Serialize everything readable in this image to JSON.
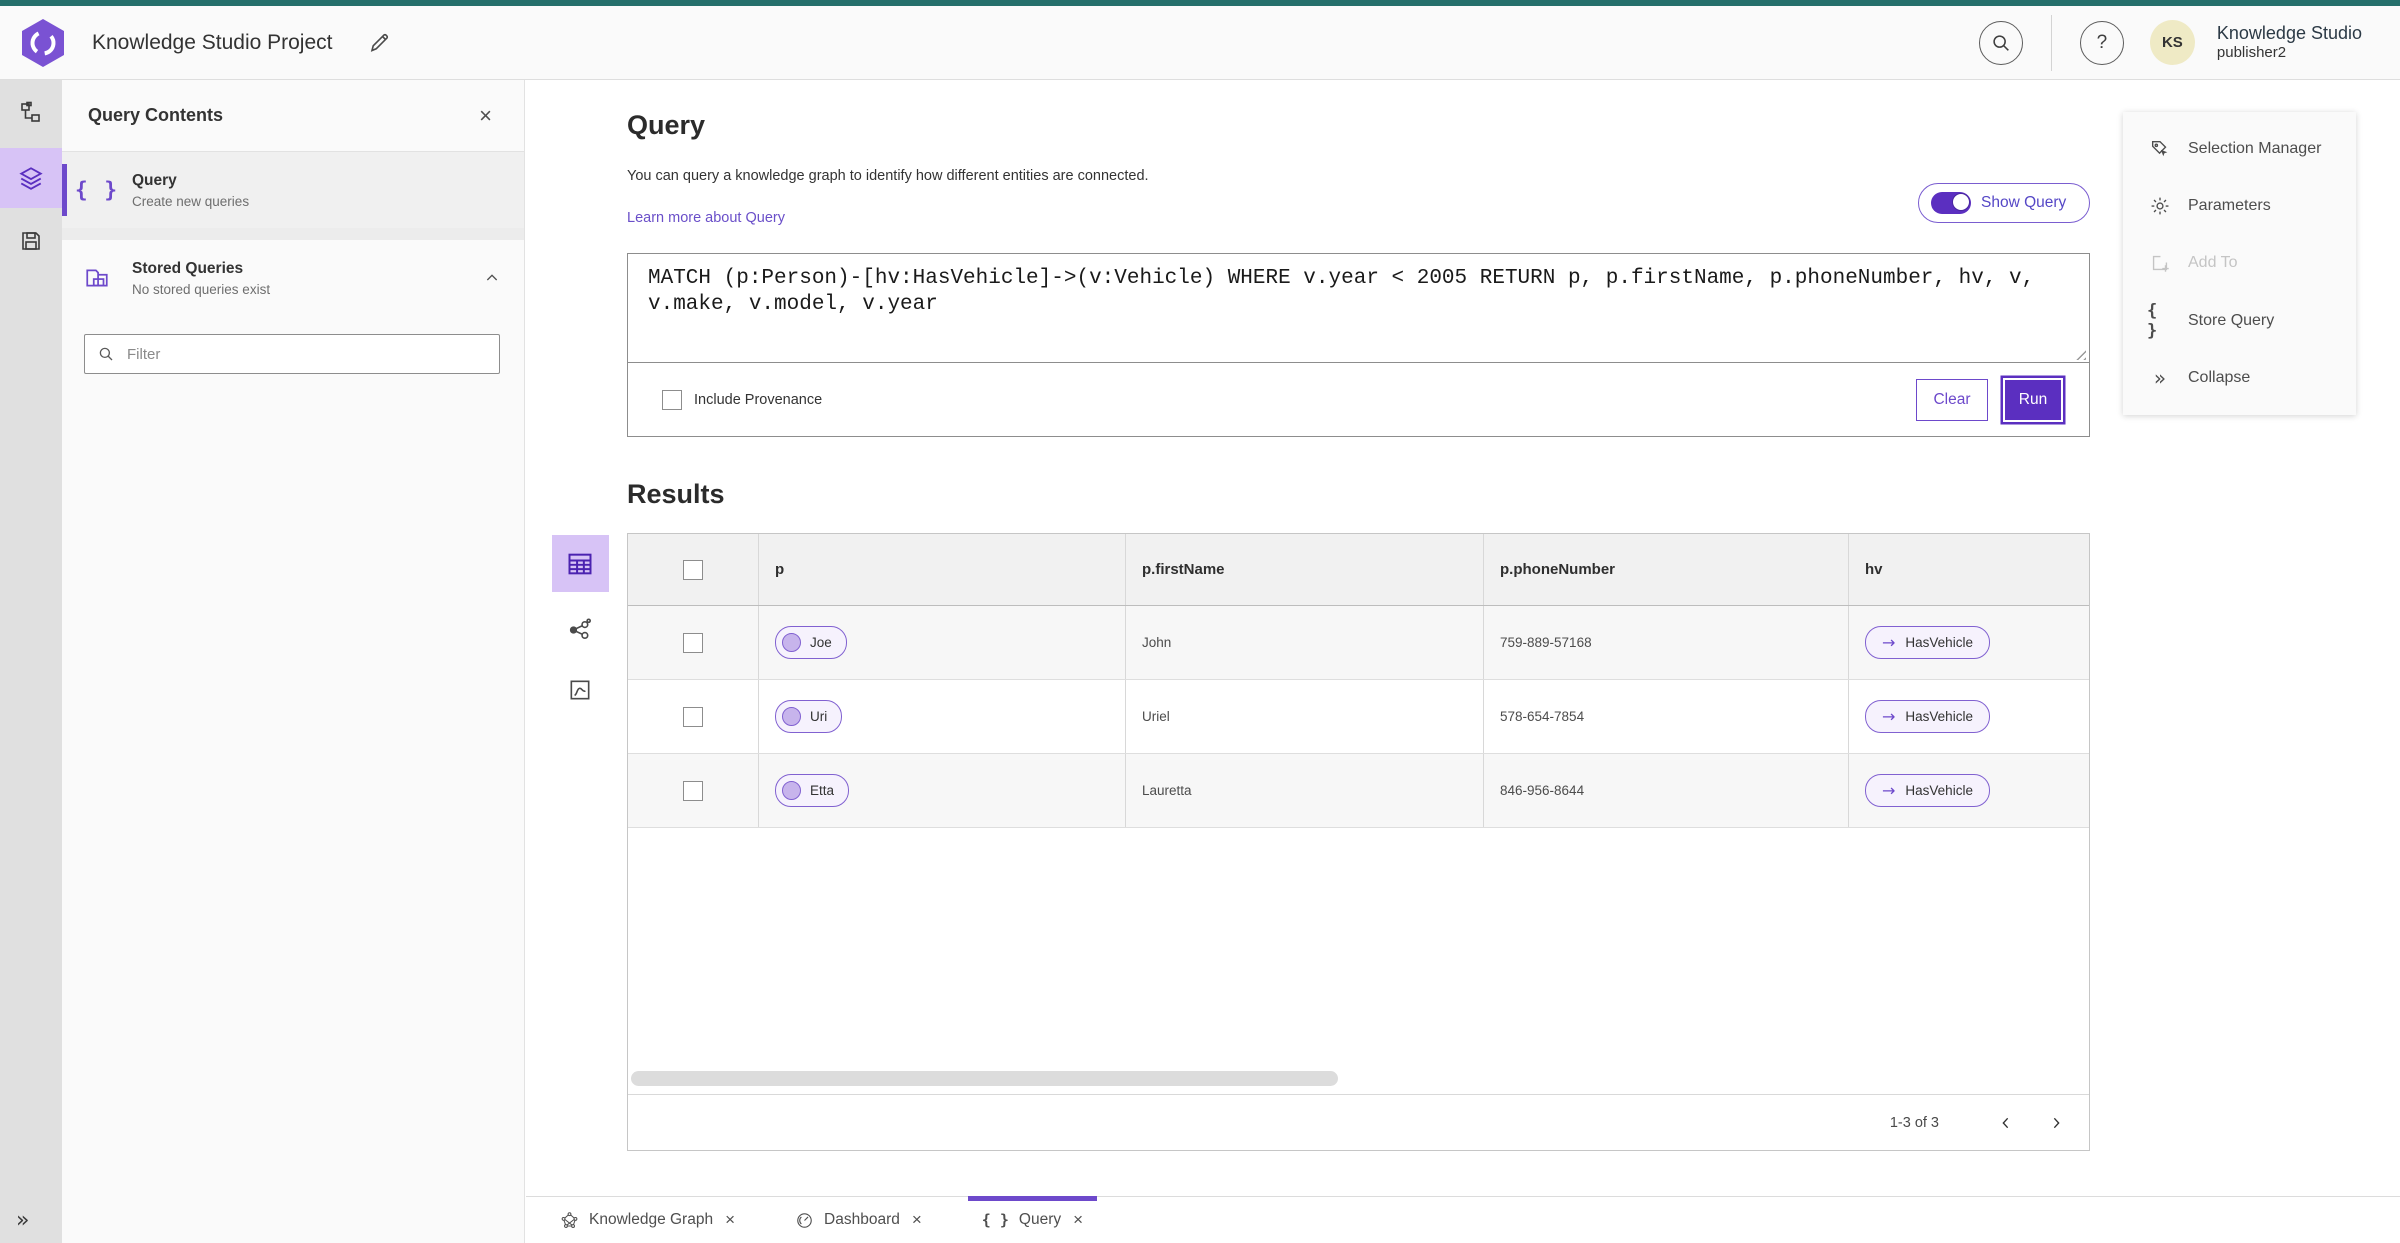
{
  "header": {
    "app_title": "Knowledge Studio Project",
    "user": {
      "initials": "KS",
      "org": "Knowledge Studio",
      "name": "publisher2"
    }
  },
  "icons": {
    "help": "?",
    "close": "×",
    "braces": "{ }",
    "arrow": "→",
    "collapse": "»"
  },
  "left_panel": {
    "title": "Query Contents",
    "items": [
      {
        "label": "Query",
        "sublabel": "Create new queries"
      },
      {
        "label": "Stored Queries",
        "sublabel": "No stored queries exist"
      }
    ],
    "filter_placeholder": "Filter"
  },
  "query_section": {
    "title": "Query",
    "description": "You can query a knowledge graph to identify how different entities are connected.",
    "learn_more": "Learn more about Query",
    "show_query_label": "Show Query",
    "query_text": "MATCH (p:Person)-[hv:HasVehicle]->(v:Vehicle) WHERE v.year < 2005 RETURN p, p.firstName, p.phoneNumber, hv, v, v.make, v.model, v.year",
    "include_provenance_label": "Include Provenance",
    "clear_label": "Clear",
    "run_label": "Run"
  },
  "results": {
    "title": "Results",
    "columns": [
      "p",
      "p.firstName",
      "p.phoneNumber",
      "hv"
    ],
    "rows": [
      {
        "p": "Joe",
        "firstName": "John",
        "phoneNumber": "759-889-57168",
        "hv": "HasVehicle"
      },
      {
        "p": "Uri",
        "firstName": "Uriel",
        "phoneNumber": "578-654-7854",
        "hv": "HasVehicle"
      },
      {
        "p": "Etta",
        "firstName": "Lauretta",
        "phoneNumber": "846-956-8644",
        "hv": "HasVehicle"
      }
    ],
    "pagination": "1-3 of 3"
  },
  "right_panel": {
    "items": [
      {
        "label": "Selection Manager",
        "disabled": false
      },
      {
        "label": "Parameters",
        "disabled": false
      },
      {
        "label": "Add To",
        "disabled": true
      },
      {
        "label": "Store Query",
        "disabled": false
      },
      {
        "label": "Collapse",
        "disabled": false
      }
    ]
  },
  "tabs": [
    {
      "label": "Knowledge Graph",
      "active": false
    },
    {
      "label": "Dashboard",
      "active": false
    },
    {
      "label": "Query",
      "active": true
    }
  ],
  "colors": {
    "accent": "#6d49cb",
    "accent_dark": "#5b2fc0",
    "top_strip": "#256f6b",
    "chip_bg": "#f6f2fd",
    "chip_border": "#8161d1",
    "selected_bg": "#d7c3f6"
  }
}
